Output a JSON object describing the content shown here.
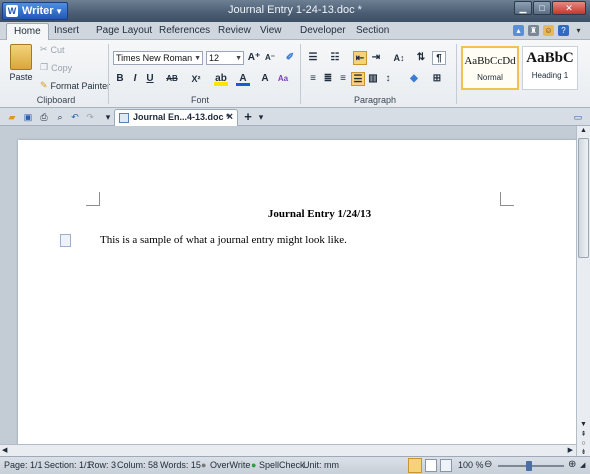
{
  "app": {
    "name": "Writer",
    "window_title": "Journal Entry 1-24-13.doc *"
  },
  "menu": {
    "tabs": [
      "Home",
      "Insert",
      "Page Layout",
      "References",
      "Review",
      "View",
      "Developer",
      "Section"
    ]
  },
  "ribbon": {
    "clipboard": {
      "paste": "Paste",
      "cut": "Cut",
      "copy": "Copy",
      "format_painter": "Format Painter",
      "label": "Clipboard"
    },
    "font": {
      "name": "Times New Roman",
      "size": "12",
      "label": "Font",
      "bold": "B",
      "italic": "I",
      "underline": "U",
      "strike": "AB",
      "superscript": "X²",
      "case": "Aa",
      "clear": "A"
    },
    "paragraph": {
      "label": "Paragraph"
    },
    "styles": {
      "normal_preview": "AaBbCcDd",
      "normal_name": "Normal",
      "heading_preview": "AaBbC",
      "heading_name": "Heading 1"
    }
  },
  "document_tab": {
    "label": "Journal En...4-13.doc *",
    "close": "×",
    "new": "+"
  },
  "document": {
    "title": "Journal Entry 1/24/13",
    "body": "This is a sample of what a journal entry might look like."
  },
  "status": {
    "page": "Page: 1/1",
    "section": "Section: 1/1",
    "row": "Row: 3",
    "column": "Colum: 58",
    "words": "Words: 15",
    "overwrite": "OverWrite",
    "spellcheck": "SpellCheck",
    "unit": "Unit: mm",
    "zoom": "100 %"
  },
  "colors": {
    "accent": "#2357b6",
    "highlight": "#f0c24f"
  }
}
